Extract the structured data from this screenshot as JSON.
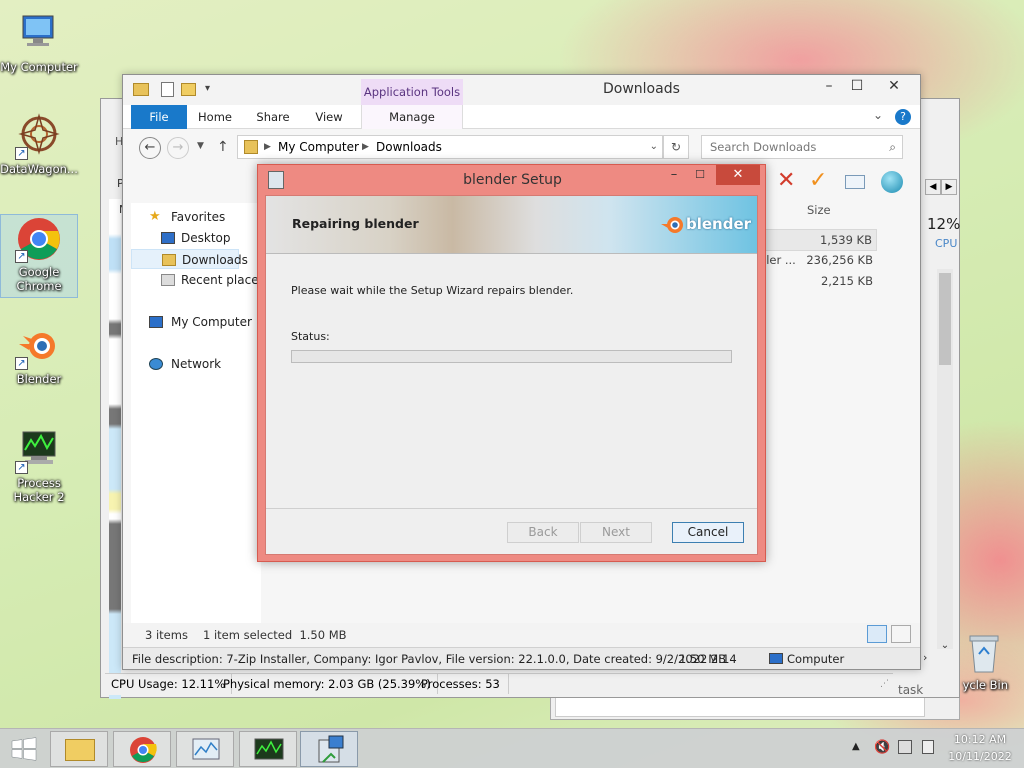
{
  "desktop": {
    "icons": [
      {
        "label": "My Computer"
      },
      {
        "label": "DataWagon..."
      },
      {
        "label": "Google Chrome"
      },
      {
        "label": "Blender"
      },
      {
        "label": "Process Hacker 2"
      },
      {
        "label": "ycle Bin"
      }
    ]
  },
  "explorer": {
    "title": "Downloads",
    "context_group": "Application Tools",
    "tabs": {
      "file": "File",
      "home": "Home",
      "share": "Share",
      "view": "View",
      "manage": "Manage"
    },
    "breadcrumb": [
      "My Computer",
      "Downloads"
    ],
    "search_placeholder": "Search Downloads",
    "nav": {
      "favorites": "Favorites",
      "desktop": "Desktop",
      "downloads": "Downloads",
      "recent": "Recent places",
      "my_computer": "My Computer",
      "network": "Network"
    },
    "column_size": "Size",
    "files": [
      {
        "type": "",
        "size": "1,539 KB"
      },
      {
        "type": "ller ...",
        "size": "236,256 KB"
      },
      {
        "type": "",
        "size": "2,215 KB"
      }
    ],
    "status_items": "3 items",
    "status_selected": "1 item selected  1.50 MB",
    "details": "File description: 7-Zip Installer, Company: Igor Pavlov, File version: 22.1.0.0, Date created: 9/2/2022 2:14",
    "details_size": "1.50 MB",
    "details_location": "Computer"
  },
  "process_hacker": {
    "cpu_label": "12%",
    "cpu_sub": "CPU",
    "cpu_usage": "CPU Usage: 12.11%",
    "physical_memory": "Physical memory: 2.03 GB (25.39%)",
    "processes": "Processes: 53",
    "task_fragment": "task",
    "row_letters": [
      "H",
      "P",
      "N"
    ]
  },
  "setup": {
    "title": "blender Setup",
    "heading": "Repairing blender",
    "logo_text": "blender",
    "message": "Please wait while the Setup Wizard repairs blender.",
    "status_label": "Status:",
    "progress": 0,
    "back": "Back",
    "next": "Next",
    "cancel": "Cancel"
  },
  "taskbar": {
    "time": "10:12 AM",
    "date": "10/11/2022"
  }
}
